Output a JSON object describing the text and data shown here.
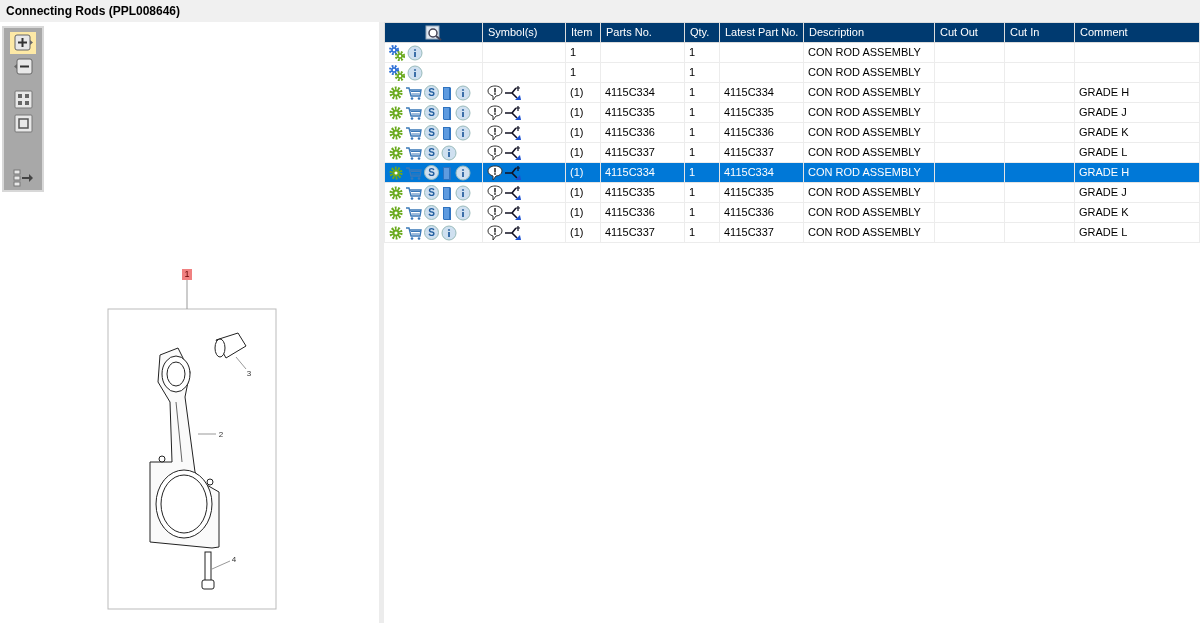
{
  "window": {
    "title": "Connecting Rods (PPL008646)"
  },
  "tools": [
    {
      "kind": "zoom_in",
      "selected": true
    },
    {
      "kind": "zoom_out",
      "selected": false
    },
    {
      "kind": "fit_all",
      "selected": false
    },
    {
      "kind": "fit_one",
      "selected": false
    },
    {
      "kind": "panel",
      "selected": false
    }
  ],
  "illustration": {
    "callouts": [
      "1",
      "2",
      "3",
      "4"
    ]
  },
  "table": {
    "columns": [
      "Symbol(s)",
      "Item",
      "Parts No.",
      "Qty.",
      "Latest Part No.",
      "Description",
      "Cut Out",
      "Cut In",
      "Comment"
    ],
    "rows": [
      {
        "kind": "assembly",
        "selected": false,
        "symbols": false,
        "item": "1",
        "qty": "1",
        "description": "CON ROD ASSEMBLY"
      },
      {
        "kind": "assembly",
        "selected": false,
        "symbols": false,
        "item": "1",
        "qty": "1",
        "description": "CON ROD ASSEMBLY"
      },
      {
        "kind": "part",
        "service_symbol": "S",
        "manual": true,
        "selected": false,
        "symbols": true,
        "item": "(1)",
        "parts_no": "4115C334",
        "qty": "1",
        "latest": "4115C334",
        "description": "CON ROD ASSEMBLY",
        "comment": "GRADE H"
      },
      {
        "kind": "part",
        "service_symbol": "S",
        "manual": true,
        "selected": false,
        "symbols": true,
        "item": "(1)",
        "parts_no": "4115C335",
        "qty": "1",
        "latest": "4115C335",
        "description": "CON ROD ASSEMBLY",
        "comment": "GRADE J"
      },
      {
        "kind": "part",
        "service_symbol": "S",
        "manual": true,
        "selected": false,
        "symbols": true,
        "item": "(1)",
        "parts_no": "4115C336",
        "qty": "1",
        "latest": "4115C336",
        "description": "CON ROD ASSEMBLY",
        "comment": "GRADE K"
      },
      {
        "kind": "part",
        "service_symbol": "S",
        "manual": false,
        "selected": false,
        "symbols": true,
        "item": "(1)",
        "parts_no": "4115C337",
        "qty": "1",
        "latest": "4115C337",
        "description": "CON ROD ASSEMBLY",
        "comment": "GRADE L"
      },
      {
        "kind": "part",
        "service_symbol": "S",
        "manual": true,
        "selected": true,
        "symbols": true,
        "item": "(1)",
        "parts_no": "4115C334",
        "qty": "1",
        "latest": "4115C334",
        "description": "CON ROD ASSEMBLY",
        "comment": "GRADE H"
      },
      {
        "kind": "part",
        "service_symbol": "S",
        "manual": true,
        "selected": false,
        "symbols": true,
        "item": "(1)",
        "parts_no": "4115C335",
        "qty": "1",
        "latest": "4115C335",
        "description": "CON ROD ASSEMBLY",
        "comment": "GRADE J"
      },
      {
        "kind": "part",
        "service_symbol": "S",
        "manual": true,
        "selected": false,
        "symbols": true,
        "item": "(1)",
        "parts_no": "4115C336",
        "qty": "1",
        "latest": "4115C336",
        "description": "CON ROD ASSEMBLY",
        "comment": "GRADE K"
      },
      {
        "kind": "part",
        "service_symbol": "S",
        "manual": false,
        "selected": false,
        "symbols": true,
        "item": "(1)",
        "parts_no": "4115C337",
        "qty": "1",
        "latest": "4115C337",
        "description": "CON ROD ASSEMBLY",
        "comment": "GRADE L"
      }
    ]
  }
}
